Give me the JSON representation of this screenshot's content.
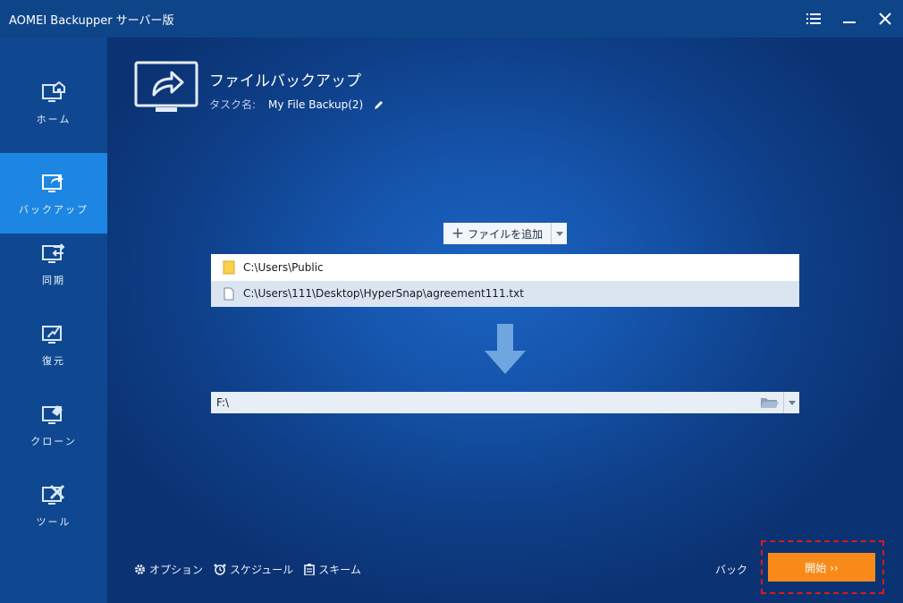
{
  "window": {
    "title": "AOMEI Backupper サーバー版",
    "controls": [
      "menu-icon",
      "minimize-icon",
      "close-icon"
    ]
  },
  "sidebar": {
    "items": [
      {
        "label": "ホーム",
        "icon": "home-icon",
        "active": false
      },
      {
        "label": "バックアップ",
        "icon": "backup-icon",
        "active": true
      },
      {
        "label": "同期",
        "icon": "sync-icon",
        "active": false
      },
      {
        "label": "復元",
        "icon": "restore-icon",
        "active": false
      },
      {
        "label": "クローン",
        "icon": "clone-icon",
        "active": false
      },
      {
        "label": "ツール",
        "icon": "tools-icon",
        "active": false
      }
    ]
  },
  "header": {
    "title": "ファイルバックアップ",
    "task_label": "タスク名:",
    "task_name": "My File Backup(2)"
  },
  "source": {
    "add_button_label": "ファイルを追加",
    "files": [
      {
        "path": "C:\\Users\\Public",
        "type": "folder",
        "selected": false
      },
      {
        "path": "C:\\Users\\111\\Desktop\\HyperSnap\\agreement111.txt",
        "type": "file",
        "selected": true
      }
    ]
  },
  "destination": {
    "value": "F:\\"
  },
  "footer": {
    "options_label": "オプション",
    "schedule_label": "スケジュール",
    "scheme_label": "スキーム",
    "back_label": "バック",
    "start_label": "開始 ››"
  },
  "colors": {
    "accent": "#1c86e2",
    "start_button": "#f98a1a",
    "highlight_border": "#e01818"
  }
}
